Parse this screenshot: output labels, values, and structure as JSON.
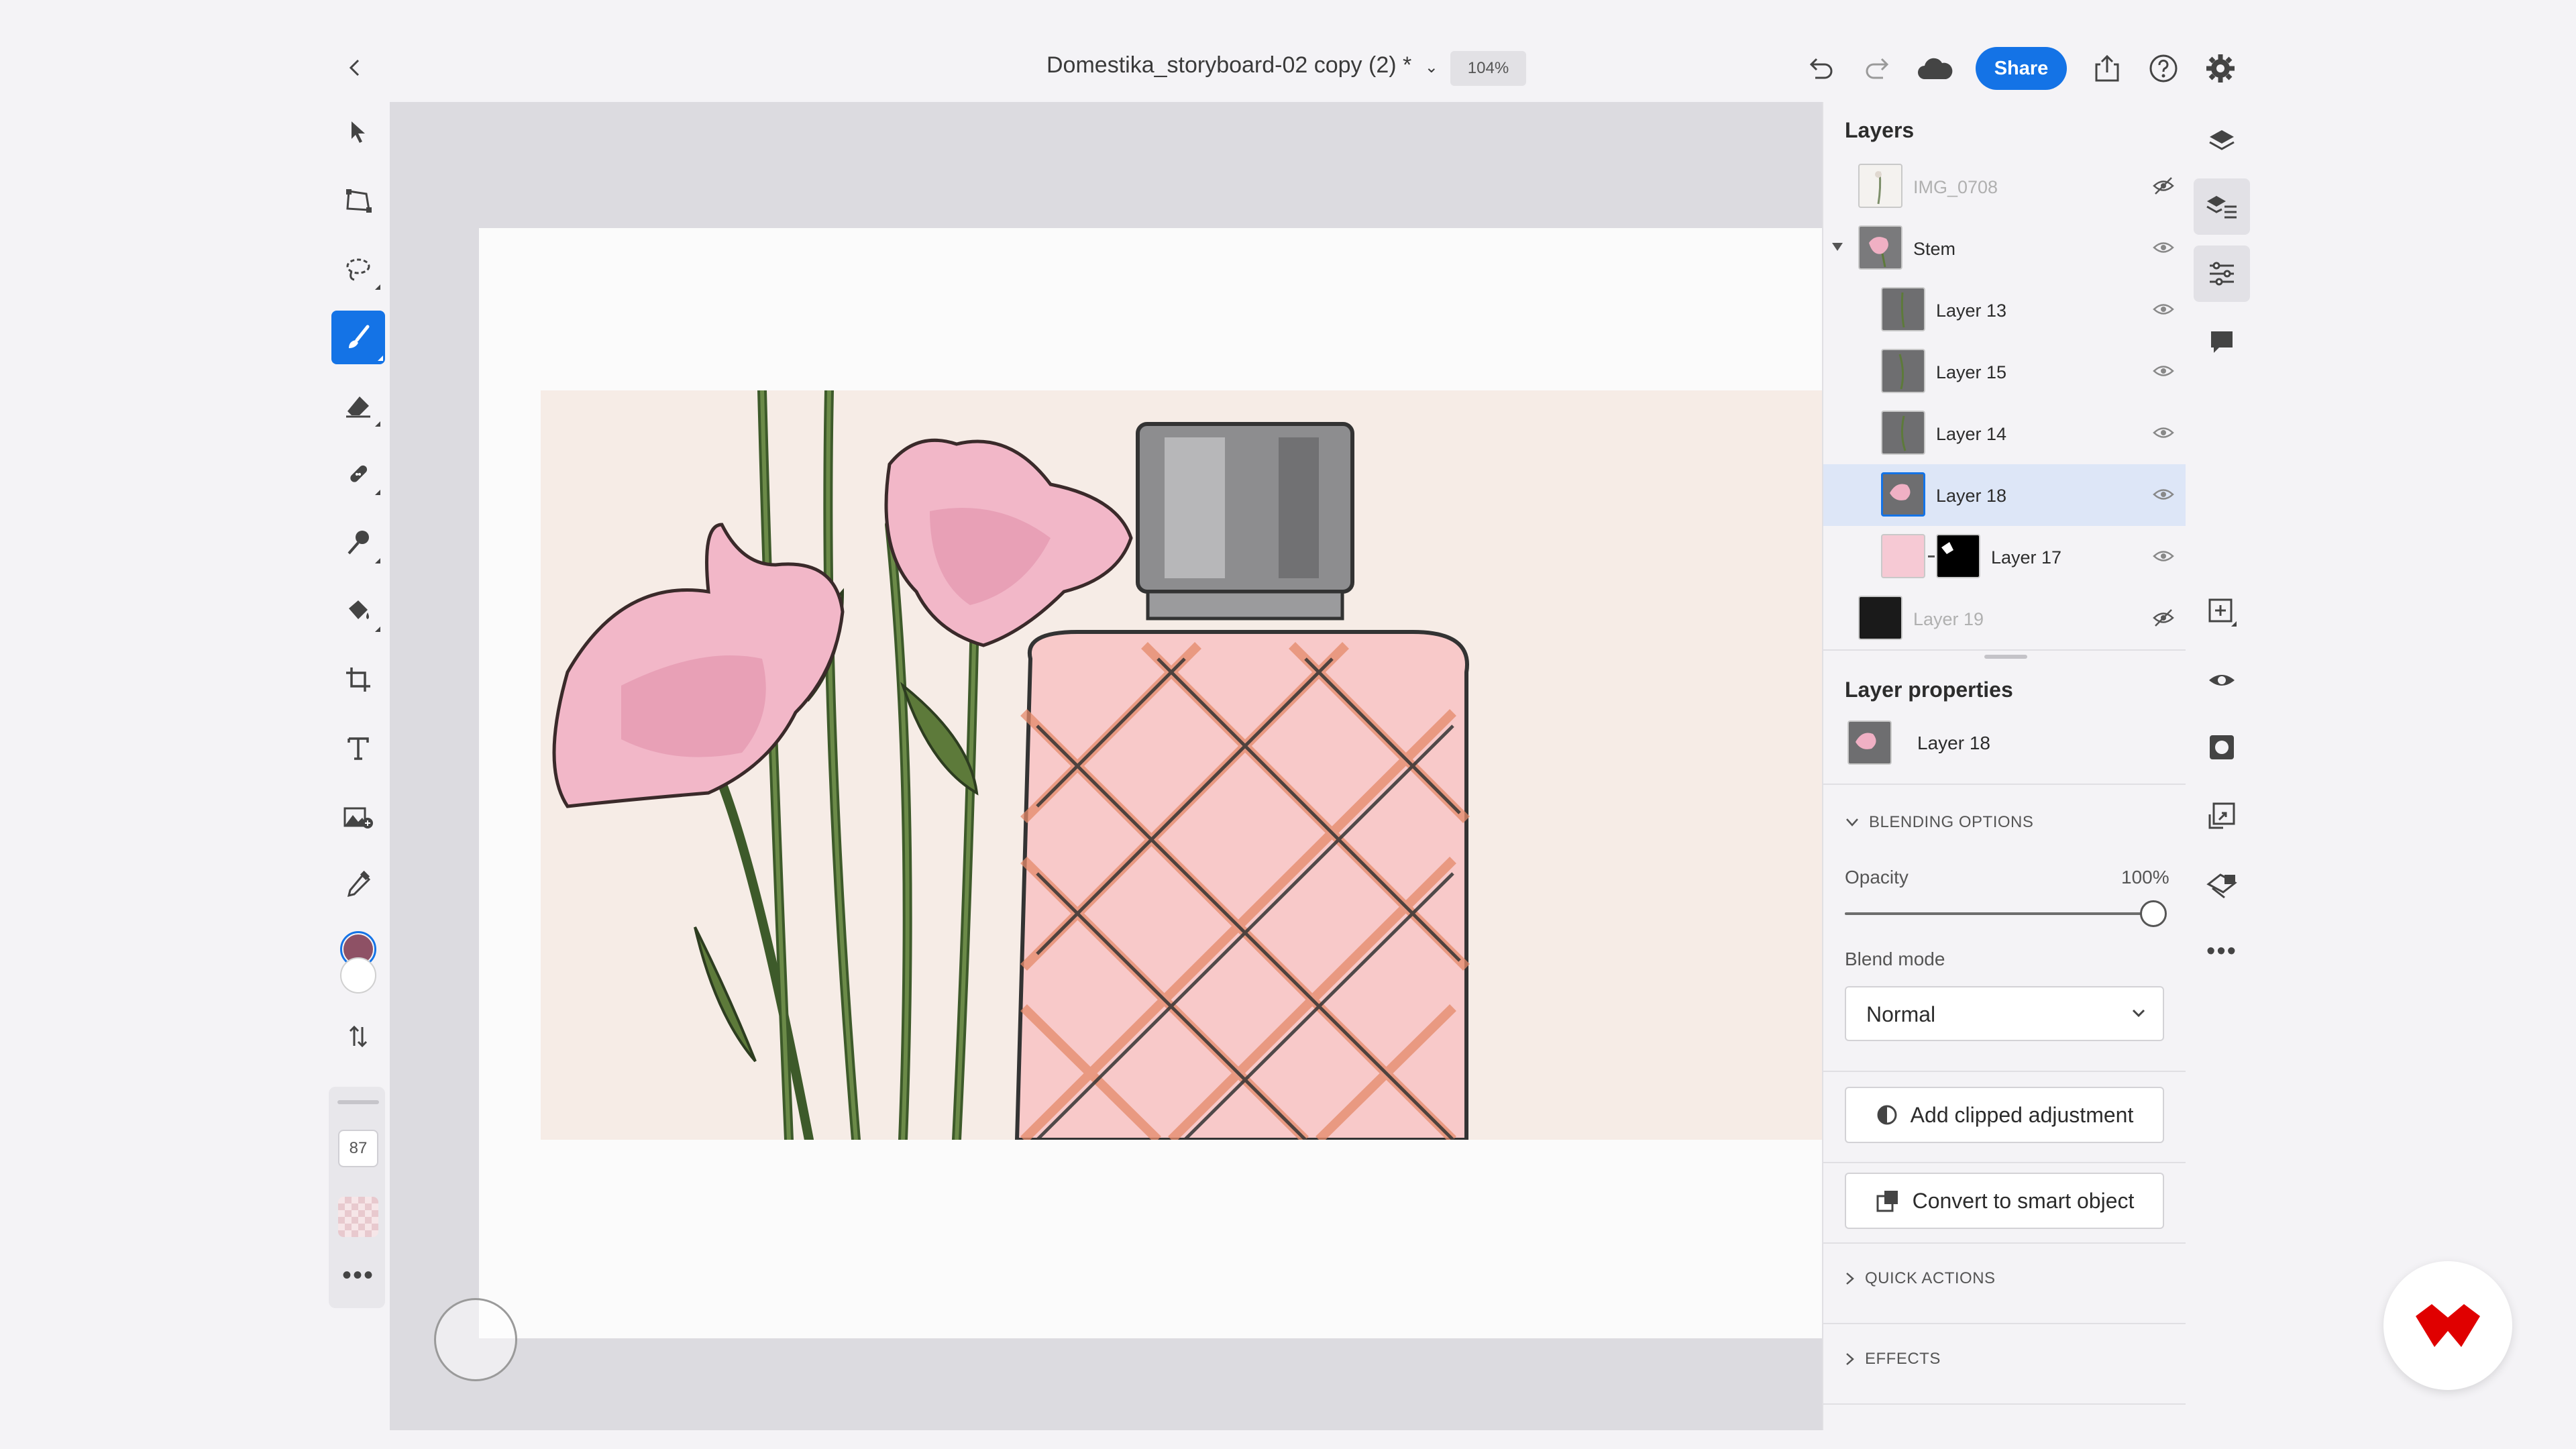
{
  "header": {
    "doc_title": "Domestika_storyboard-02 copy (2) *",
    "zoom": "104%",
    "share_label": "Share"
  },
  "toolbar": {
    "tools": [
      "select-arrow",
      "transform",
      "lasso-selection",
      "brush",
      "eraser",
      "healing",
      "smudge",
      "fill",
      "crop",
      "text",
      "place-image",
      "eyedropper"
    ],
    "selected_tool": "brush",
    "foreground_color": "#8e5165",
    "background_color": "#ffffff",
    "brush_size": "87"
  },
  "layers_panel": {
    "title": "Layers",
    "layers": [
      {
        "name": "IMG_0708",
        "hidden": true
      },
      {
        "name": "Stem",
        "group": true,
        "expanded": true
      },
      {
        "name": "Layer 13"
      },
      {
        "name": "Layer 15"
      },
      {
        "name": "Layer 14"
      },
      {
        "name": "Layer 18",
        "selected": true
      },
      {
        "name": "Layer 17",
        "mask": true
      },
      {
        "name": "Layer 19",
        "hidden": true
      }
    ]
  },
  "layer_properties": {
    "title": "Layer properties",
    "layer_name": "Layer 18",
    "blending_header": "BLENDING OPTIONS",
    "opacity_label": "Opacity",
    "opacity_value": "100%",
    "opacity_fraction": 1.0,
    "blend_mode_label": "Blend mode",
    "blend_mode_value": "Normal",
    "add_clipped_label": "Add clipped adjustment",
    "convert_smart_label": "Convert to smart object",
    "quick_actions_header": "QUICK ACTIONS",
    "effects_header": "EFFECTS"
  },
  "colors": {
    "accent": "#1473e6",
    "selection_row": "#dde6f7",
    "logo_red": "#e00000"
  }
}
